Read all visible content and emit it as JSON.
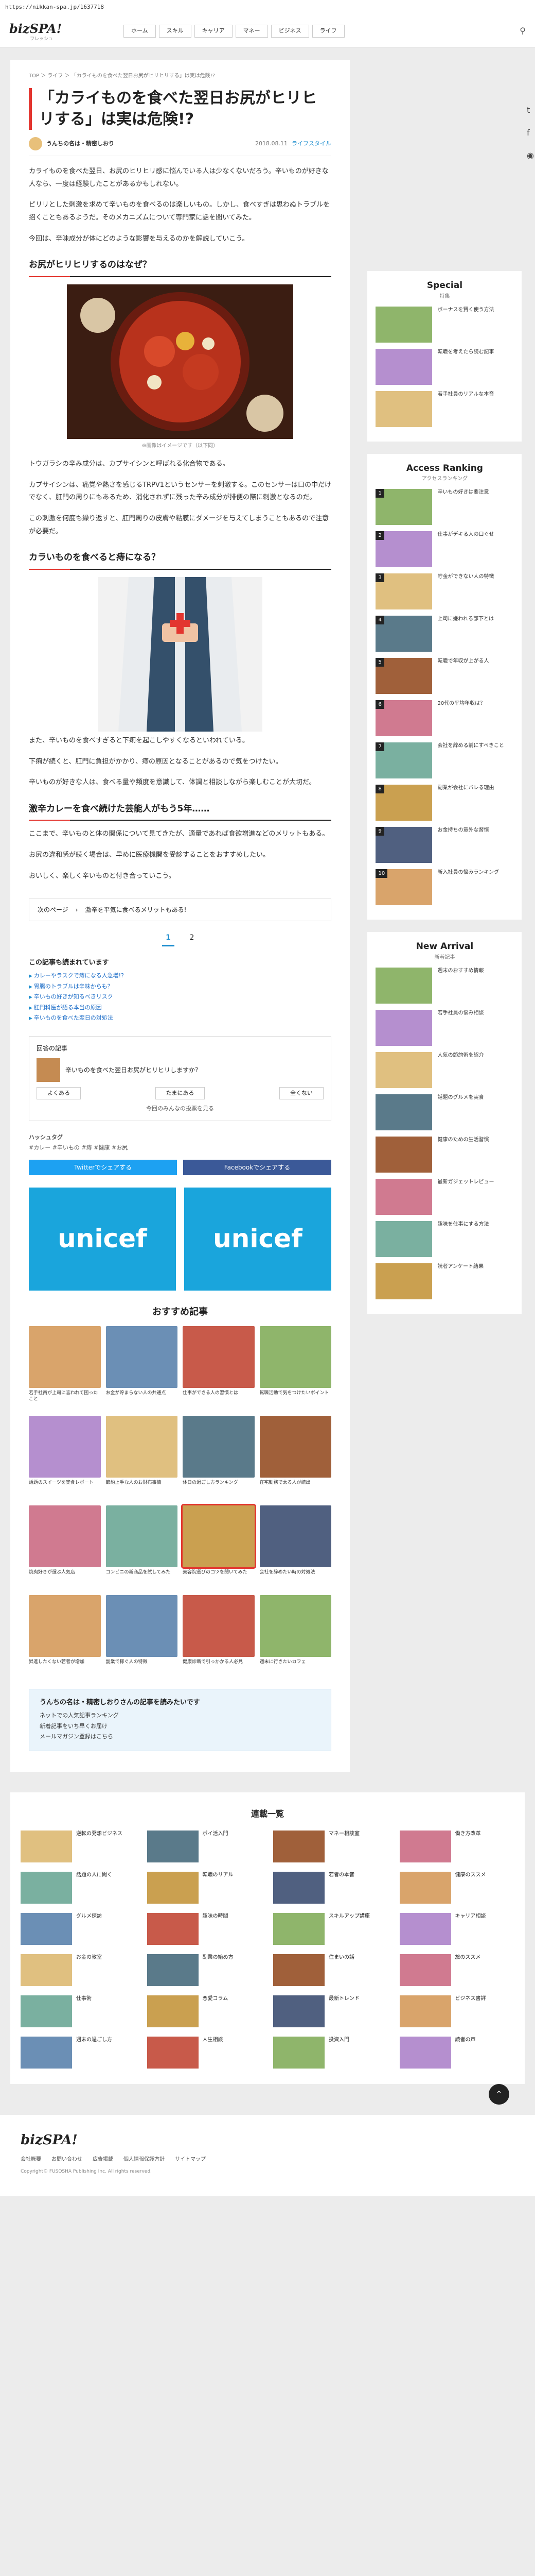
{
  "url": "https://nikkan-spa.jp/1637718",
  "header": {
    "logo": "bizSPA!",
    "logo_sub": "フレッシュ",
    "nav": [
      "ホーム",
      "スキル",
      "キャリア",
      "マネー",
      "ビジネス",
      "ライフ"
    ],
    "search_icon": "search-icon"
  },
  "breadcrumb": "TOP ＞ ライフ ＞ 「カライものを食べた翌日お尻がヒリヒリする」は実は危険!?",
  "article": {
    "title": "「カライものを食べた翌日お尻がヒリヒリする」は実は危険!?",
    "author": "うんちの名は・精密しおり",
    "date": "2018.08.11",
    "category": "ライフスタイル",
    "p1": "カライものを食べた翌日、お尻のヒリヒリ感に悩んでいる人は少なくないだろう。辛いものが好きな人なら、一度は経験したことがあるかもしれない。",
    "p2": "ピリリとした刺激を求めて辛いものを食べるのは楽しいもの。しかし、食べすぎは思わぬトラブルを招くこともあるようだ。そのメカニズムについて専門家に話を聞いてみた。",
    "p3": "今回は、辛味成分が体にどのような影響を与えるのかを解説していこう。",
    "h2a": "お尻がヒリヒリするのはなぜ？",
    "cap1": "※画像はイメージです（以下同）",
    "p4": "トウガラシの辛み成分は、カプサイシンと呼ばれる化合物である。",
    "p5": "カプサイシンは、痛覚や熱さを感じるTRPV1というセンサーを刺激する。このセンサーは口の中だけでなく、肛門の周りにもあるため、消化されずに残った辛み成分が排便の際に刺激となるのだ。",
    "p6": "この刺激を何度も繰り返すと、肛門周りの皮膚や粘膜にダメージを与えてしまうこともあるので注意が必要だ。",
    "h2b": "カラいものを食べると痔になる？",
    "p7": "また、辛いものを食べすぎると下痢を起こしやすくなるといわれている。",
    "p8": "下痢が続くと、肛門に負担がかかり、痔の原因となることがあるので気をつけたい。",
    "p9": "辛いものが好きな人は、食べる量や頻度を意識して、体調と相談しながら楽しむことが大切だ。",
    "h2c": "激辛カレーを食べ続けた芸能人がもう5年……",
    "p10": "ここまで、辛いものと体の関係について見てきたが、適量であれば食欲増進などのメリットもある。",
    "p11": "お尻の違和感が続く場合は、早めに医療機関を受診することをおすすめしたい。",
    "p12": "おいしく、楽しく辛いものと付き合っていこう。"
  },
  "next": {
    "label": "次のページ",
    "text": "激辛を平気に食べるメリットもある!"
  },
  "pager": [
    "1",
    "2"
  ],
  "related": {
    "title": "この記事も読まれています",
    "items": [
      "カレーやラスクで痔になる人急増!?",
      "胃腸のトラブルは辛味からも？",
      "辛いもの好きが知るべきリスク",
      "肛門科医が語る本当の原因",
      "辛いものを食べた翌日の対処法"
    ]
  },
  "vote": {
    "title": "回答の記事",
    "question": "辛いものを食べた翌日お尻がヒリヒリしますか？",
    "opts": [
      "よくある",
      "たまにある",
      "全くない"
    ],
    "result": "今回のみんなの投票を見る"
  },
  "tags": {
    "title": "ハッシュタグ",
    "text": "#カレー #辛いもの #痔 #健康 #お尻"
  },
  "share": {
    "twitter": "Twitterでシェアする",
    "facebook": "Facebookでシェアする"
  },
  "ads": {
    "a": "unicef",
    "b": "unicef"
  },
  "recommend": {
    "title": "おすすめ記事",
    "items": [
      "若手社員が上司に言われて困ったこと",
      "お金が貯まらない人の共通点",
      "仕事ができる人の習慣とは",
      "転職活動で気をつけたいポイント",
      "話題のスイーツを実食レポート",
      "節約上手な人のお財布事情",
      "休日の過ごし方ランキング",
      "在宅勤務で太る人が続出",
      "焼肉好きが選ぶ人気店",
      "コンビニの新商品を試してみた",
      "美容院選びのコツを聞いてみた",
      "会社を辞めたい時の対処法",
      "昇進したくない若者が増加",
      "副業で稼ぐ人の特徴",
      "健康診断で引っかかる人必見",
      "週末に行きたいカフェ"
    ]
  },
  "mail": {
    "title": "うんちの名は・精密しおりさんの記事を読みたいです",
    "items": [
      "ネットでの人気記事ランキング",
      "新着記事をいち早くお届け",
      "メールマガジン登録はこちら"
    ]
  },
  "side": {
    "special": {
      "title": "Special",
      "sub": "特集",
      "items": [
        "ボーナスを賢く使う方法",
        "転職を考えたら読む記事",
        "若手社員のリアルな本音"
      ]
    },
    "ranking": {
      "title": "Access Ranking",
      "sub": "アクセスランキング",
      "items": [
        "辛いもの好きは要注意",
        "仕事がデキる人の口ぐせ",
        "貯金ができない人の特徴",
        "上司に嫌われる部下とは",
        "転職で年収が上がる人",
        "20代の平均年収は？",
        "会社を辞める前にすべきこと",
        "副業が会社にバレる理由",
        "お金持ちの意外な習慣",
        "新入社員の悩みランキング"
      ]
    },
    "new": {
      "title": "New Arrival",
      "sub": "新着記事",
      "items": [
        "週末のおすすめ情報",
        "若手社員の悩み相談",
        "人気の節約術を紹介",
        "話題のグルメを実食",
        "健康のための生活習慣",
        "最新ガジェットレビュー",
        "趣味を仕事にする方法",
        "読者アンケート結果"
      ]
    }
  },
  "list": {
    "title": "連載一覧",
    "items": [
      "逆転の発想ビジネス",
      "ポイ活入門",
      "マネー相談室",
      "働き方改革",
      "話題の人に聞く",
      "転職のリアル",
      "若者の本音",
      "健康のススメ",
      "グルメ探訪",
      "趣味の時間",
      "スキルアップ講座",
      "キャリア相談",
      "お金の教室",
      "副業の始め方",
      "住まいの話",
      "旅のススメ",
      "仕事術",
      "恋愛コラム",
      "最新トレンド",
      "ビジネス書評",
      "週末の過ごし方",
      "人生相談",
      "投資入門",
      "読者の声"
    ]
  },
  "footer": {
    "logo": "bizSPA!",
    "links": [
      "会社概要",
      "お問い合わせ",
      "広告掲載",
      "個人情報保護方針",
      "サイトマップ"
    ],
    "copy": "Copyright© FUSOSHA Publishing Inc. All rights reserved."
  }
}
